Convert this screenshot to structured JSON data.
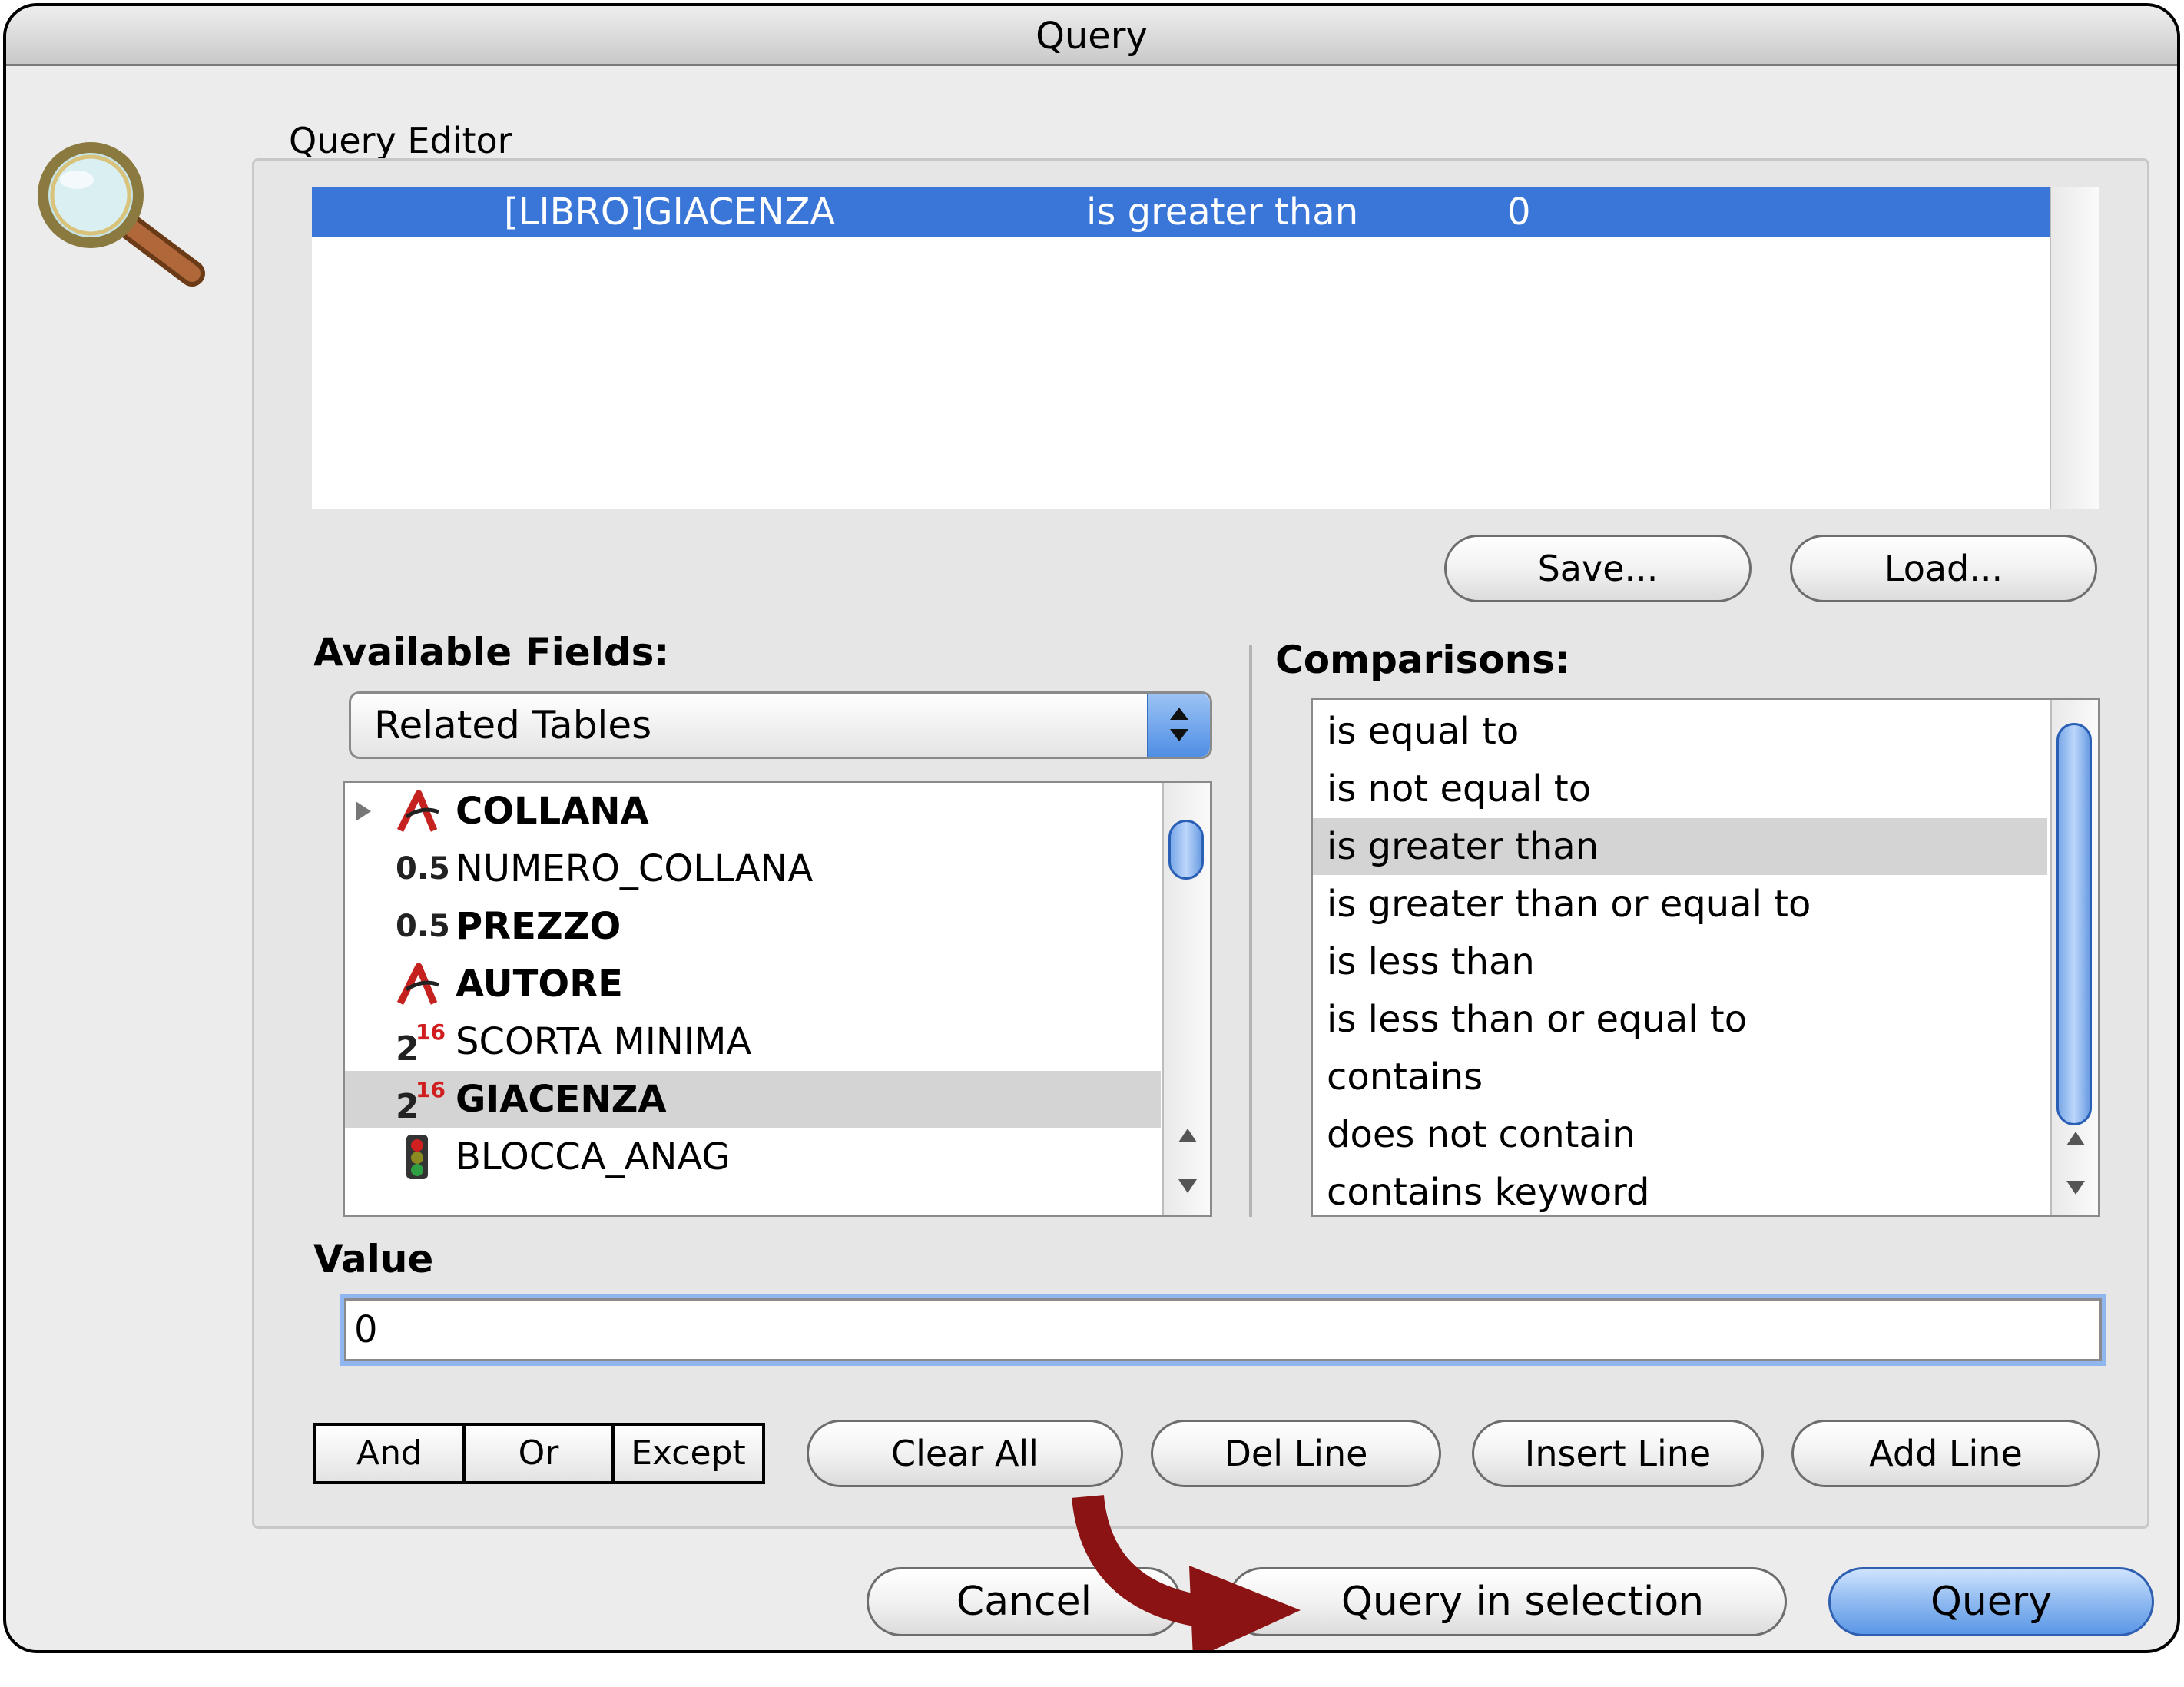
{
  "window": {
    "title": "Query"
  },
  "group": {
    "label": "Query Editor"
  },
  "query_line": {
    "field": "[LIBRO]GIACENZA",
    "comparison": "is greater than",
    "value": "0"
  },
  "buttons": {
    "save": "Save...",
    "load": "Load...",
    "clear_all": "Clear All",
    "del_line": "Del Line",
    "insert_line": "Insert Line",
    "add_line": "Add Line",
    "cancel": "Cancel",
    "query_in_selection": "Query in selection",
    "query": "Query"
  },
  "conjunctions": [
    "And",
    "Or",
    "Except"
  ],
  "available_fields": {
    "label": "Available Fields:",
    "popup_selected": "Related Tables",
    "items": [
      {
        "icon": "alpha-icon",
        "label": "COLLANA",
        "bold": true,
        "expandable": true
      },
      {
        "icon": "real-icon",
        "icon_text": "0.5",
        "label": "NUMERO_COLLANA",
        "bold": false
      },
      {
        "icon": "real-icon",
        "icon_text": "0.5",
        "label": "PREZZO",
        "bold": true
      },
      {
        "icon": "alpha-icon",
        "label": "AUTORE",
        "bold": true
      },
      {
        "icon": "integer-icon",
        "icon_text": "2",
        "icon_sup": "16",
        "label": "SCORTA MINIMA",
        "bold": false
      },
      {
        "icon": "integer-icon",
        "icon_text": "2",
        "icon_sup": "16",
        "label": "GIACENZA",
        "bold": true,
        "selected": true
      },
      {
        "icon": "boolean-traffic-light-icon",
        "label": "BLOCCA_ANAG",
        "bold": false
      }
    ]
  },
  "comparisons": {
    "label": "Comparisons:",
    "items": [
      "is equal to",
      "is not equal to",
      "is greater than",
      "is greater than or equal to",
      "is less than",
      "is less than or equal to",
      "contains",
      "does not contain",
      "contains keyword"
    ],
    "selected_index": 2
  },
  "value": {
    "label": "Value",
    "current": "0"
  },
  "colors": {
    "selection_blue": "#3a76d8",
    "annotation_arrow": "#8b1313"
  }
}
